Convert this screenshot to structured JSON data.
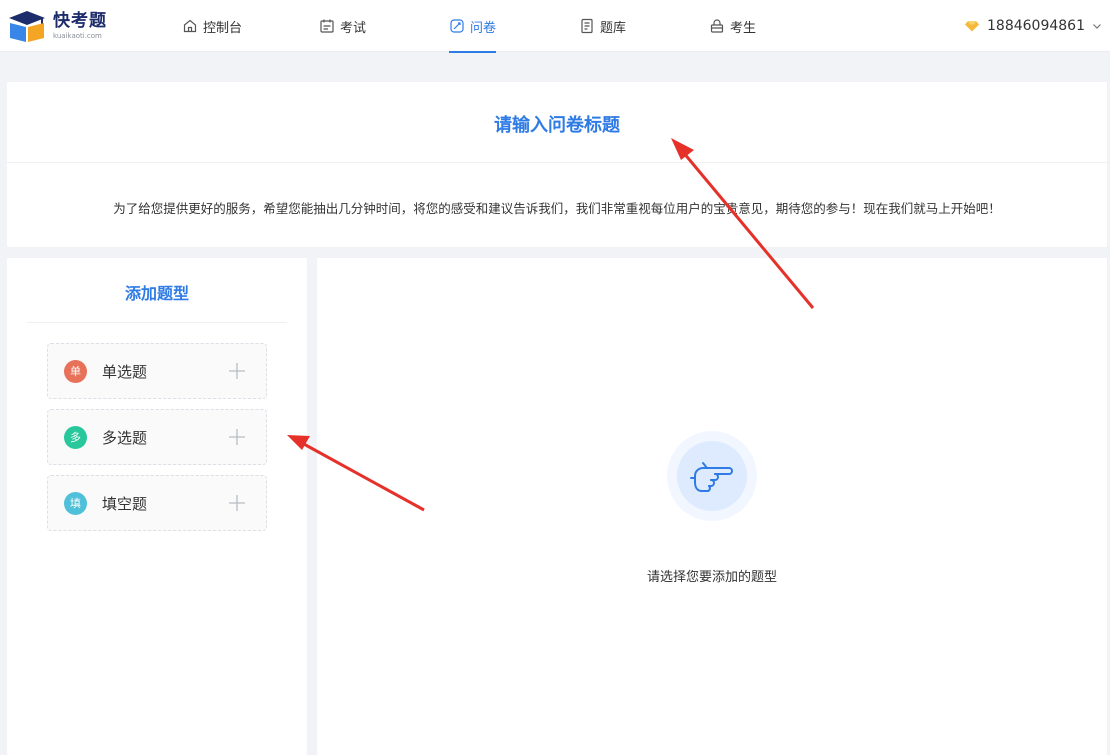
{
  "brand": {
    "name": "快考题",
    "domain": "kuaikaoti.com"
  },
  "nav": {
    "items": [
      {
        "label": "控制台",
        "icon": "home-icon"
      },
      {
        "label": "考试",
        "icon": "calendar-icon"
      },
      {
        "label": "问卷",
        "icon": "questionnaire-icon",
        "active": true
      },
      {
        "label": "题库",
        "icon": "question-bank-icon"
      },
      {
        "label": "考生",
        "icon": "lock-icon"
      }
    ]
  },
  "user": {
    "phone": "18846094861",
    "icon": "diamond-icon"
  },
  "survey": {
    "title_placeholder": "请输入问卷标题",
    "description": "为了给您提供更好的服务，希望您能抽出几分钟时间，将您的感受和建议告诉我们，我们非常重视每位用户的宝贵意见，期待您的参与！现在我们就马上开始吧！"
  },
  "add_panel": {
    "title": "添加题型",
    "types": [
      {
        "badge": "单",
        "label": "单选题",
        "color": "#e8715a"
      },
      {
        "badge": "多",
        "label": "多选题",
        "color": "#28c79c"
      },
      {
        "badge": "填",
        "label": "填空题",
        "color": "#4fc0d9"
      }
    ]
  },
  "empty_state": {
    "text": "请选择您要添加的题型",
    "icon": "pointing-hand-icon"
  },
  "colors": {
    "accent": "#2f7be5",
    "annotation_arrow": "#e5312a"
  }
}
